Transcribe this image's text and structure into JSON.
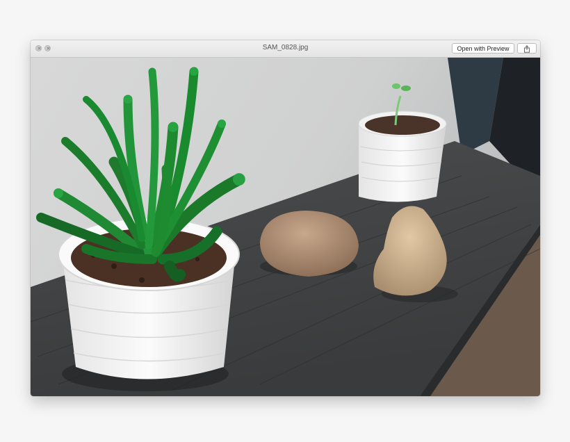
{
  "window": {
    "title": "SAM_0828.jpg",
    "open_button_label": "Open with Preview",
    "share_icon": "share-icon",
    "close_icon": "close-icon",
    "fullscreen_icon": "fullscreen-icon"
  },
  "photo": {
    "icon": "photo-icon"
  }
}
